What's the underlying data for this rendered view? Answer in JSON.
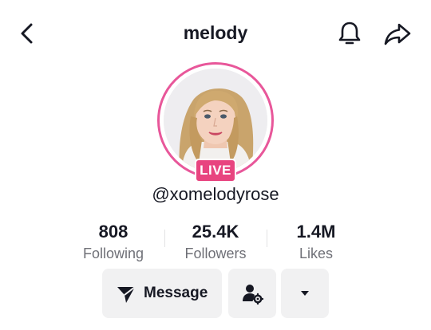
{
  "header": {
    "title": "melody",
    "back_icon": "chevron-left-icon",
    "bell_icon": "bell-icon",
    "share_icon": "share-arrow-icon"
  },
  "profile": {
    "avatar": "profile-photo",
    "live_badge": "LIVE",
    "username": "@xomelodyrose"
  },
  "stats": [
    {
      "value": "808",
      "label": "Following"
    },
    {
      "value": "25.4K",
      "label": "Followers"
    },
    {
      "value": "1.4M",
      "label": "Likes"
    }
  ],
  "actions": {
    "message_label": "Message",
    "message_icon": "send-icon",
    "person_icon": "person-settings-icon",
    "more_icon": "caret-down-icon"
  },
  "colors": {
    "accent": "#e8447f",
    "ring": "#e8579a",
    "text": "#161823",
    "muted": "#6f7077",
    "button_bg": "#f1f1f2"
  }
}
